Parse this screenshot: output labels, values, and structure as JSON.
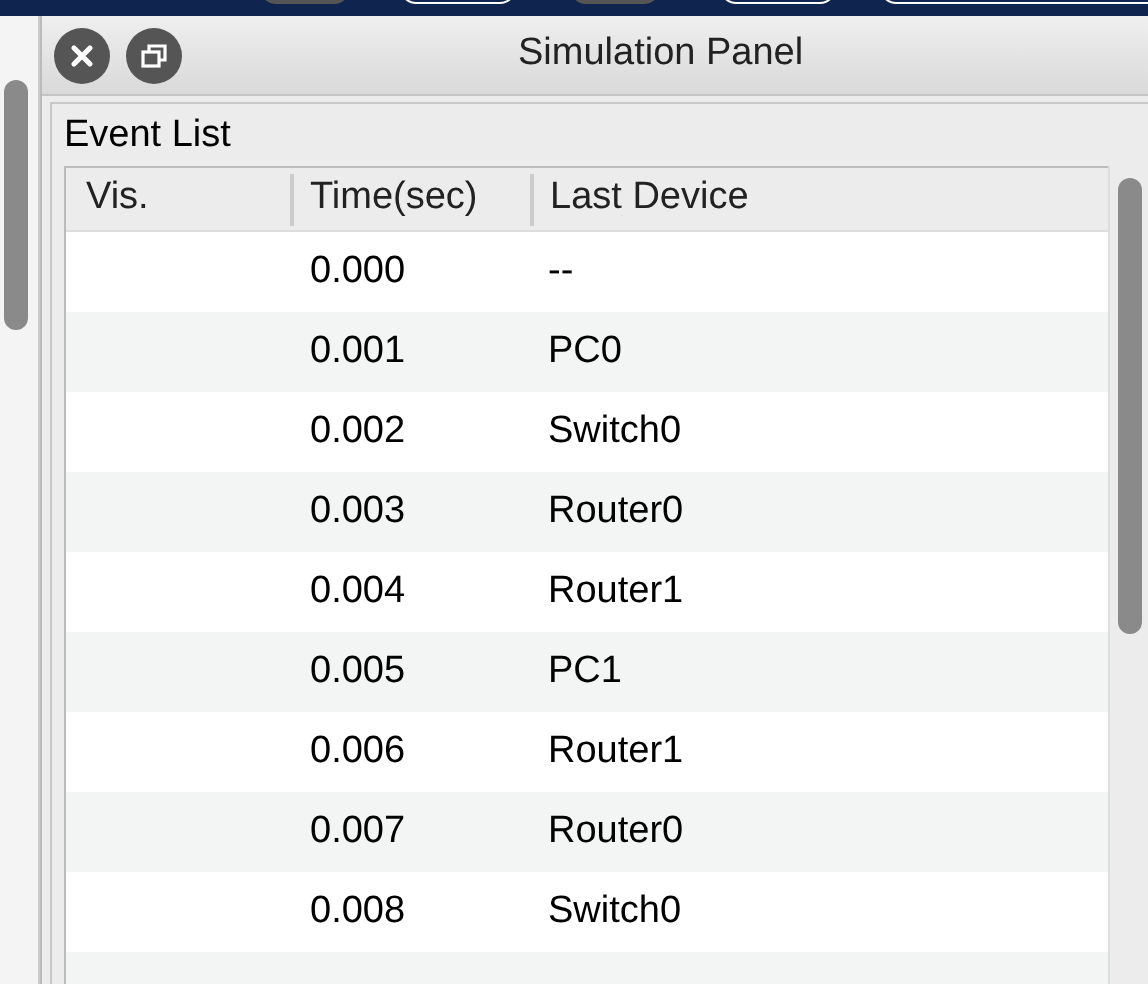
{
  "window": {
    "title": "Simulation Panel"
  },
  "section_title": "Event List",
  "table": {
    "columns": [
      "Vis.",
      "Time(sec)",
      "Last Device"
    ],
    "rows": [
      {
        "time": "0.000",
        "device": "--"
      },
      {
        "time": "0.001",
        "device": "PC0"
      },
      {
        "time": "0.002",
        "device": "Switch0"
      },
      {
        "time": "0.003",
        "device": "Router0"
      },
      {
        "time": "0.004",
        "device": "Router1"
      },
      {
        "time": "0.005",
        "device": "PC1"
      },
      {
        "time": "0.006",
        "device": "Router1"
      },
      {
        "time": "0.007",
        "device": "Router0"
      },
      {
        "time": "0.008",
        "device": "Switch0"
      }
    ]
  }
}
